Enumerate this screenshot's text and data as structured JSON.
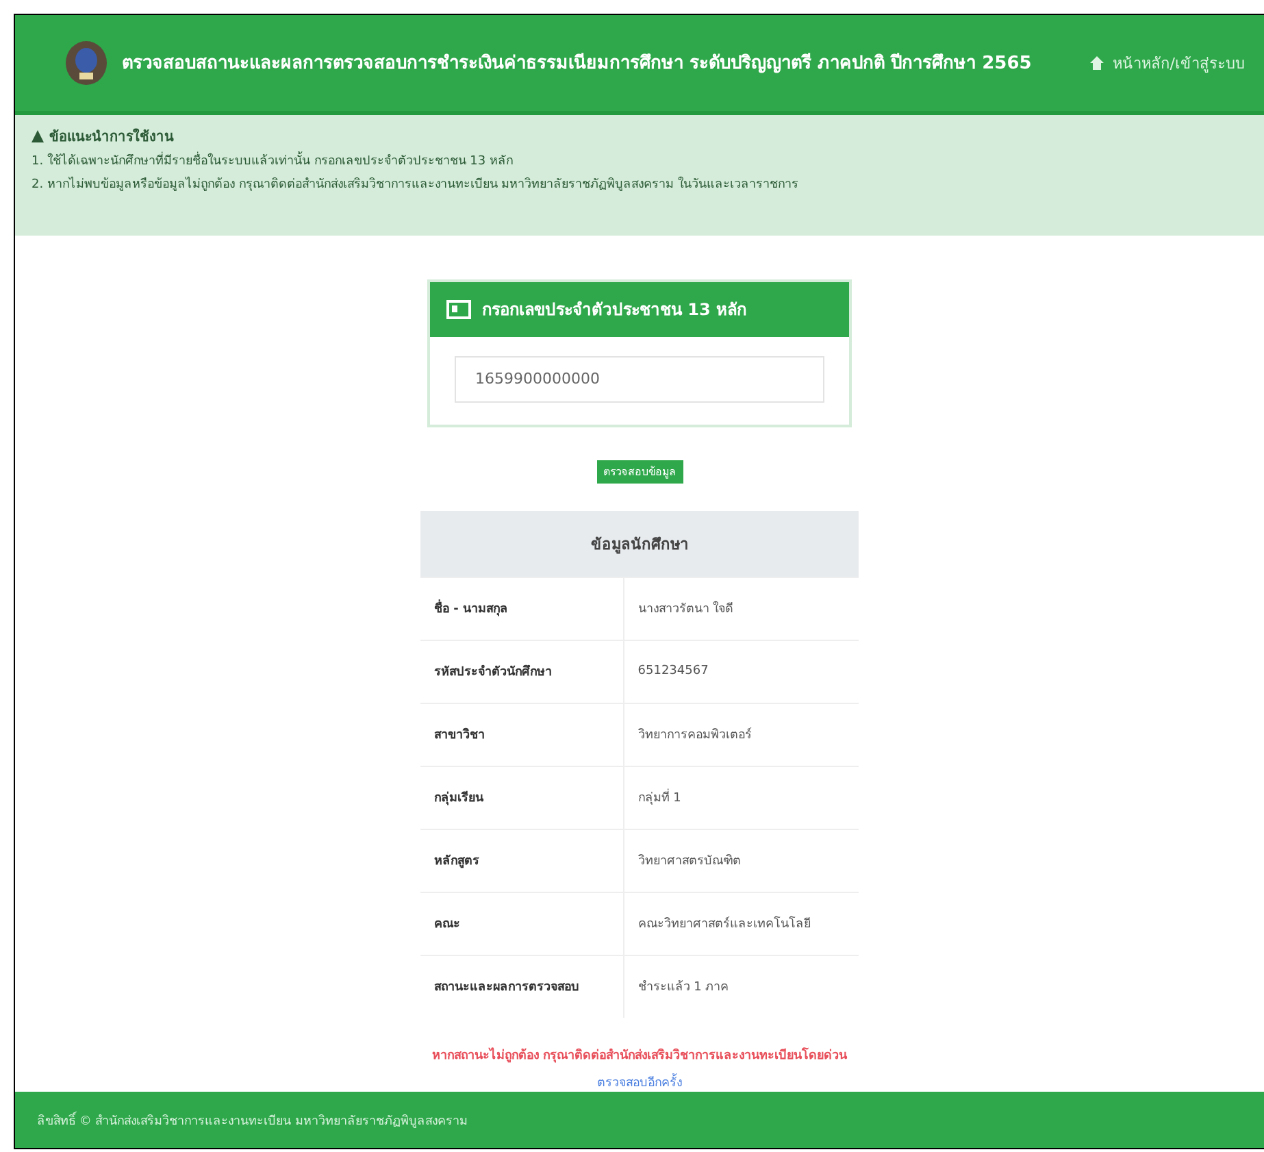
{
  "header": {
    "title": "ตรวจสอบสถานะและผลการตรวจสอบการชำระเงินค่าธรรมเนียมการศึกษา ระดับปริญญาตรี ภาคปกติ ปีการศึกษา 2565",
    "nav_link": "หน้าหลัก/เข้าสู่ระบบ"
  },
  "notice": {
    "title": "ข้อแนะนำการใช้งาน",
    "lines": [
      "1. ใช้ได้เฉพาะนักศึกษาที่มีรายชื่อในระบบแล้วเท่านั้น กรอกเลขประจำตัวประชาชน 13 หลัก",
      "2. หากไม่พบข้อมูลหรือข้อมูลไม่ถูกต้อง กรุณาติดต่อสำนักส่งเสริมวิชาการและงานทะเบียน มหาวิทยาลัยราชภัฏพิบูลสงคราม ในวันและเวลาราชการ"
    ]
  },
  "search_card": {
    "title": "กรอกเลขประจำตัวประชาชน 13 หลัก",
    "value": "1659900000000",
    "button": "ตรวจสอบข้อมูล"
  },
  "student_table": {
    "title": "ข้อมูลนักศึกษา",
    "rows": [
      {
        "label": "ชื่อ - นามสกุล",
        "value": "นางสาวรัตนา ใจดี"
      },
      {
        "label": "รหัสประจำตัวนักศึกษา",
        "value": "651234567"
      },
      {
        "label": "สาขาวิชา",
        "value": "วิทยาการคอมพิวเตอร์"
      },
      {
        "label": "กลุ่มเรียน",
        "value": "กลุ่มที่ 1"
      },
      {
        "label": "หลักสูตร",
        "value": "วิทยาศาสตรบัณฑิต"
      },
      {
        "label": "คณะ",
        "value": "คณะวิทยาศาสตร์และเทคโนโลยี"
      },
      {
        "label": "สถานะและผลการตรวจสอบ",
        "value": "ชำระแล้ว 1 ภาค"
      }
    ]
  },
  "warning": "**หากสถานะไม่ถูกต้อง กรุณาติดต่อสำนักส่งเสริมวิชาการและงานทะเบียนโดยด่วน**",
  "back_link": "ตรวจสอบอีกครั้ง",
  "footer": "ลิขสิทธิ์ © สำนักส่งเสริมวิชาการและงานทะเบียน มหาวิทยาลัยราชภัฏพิบูลสงคราม"
}
